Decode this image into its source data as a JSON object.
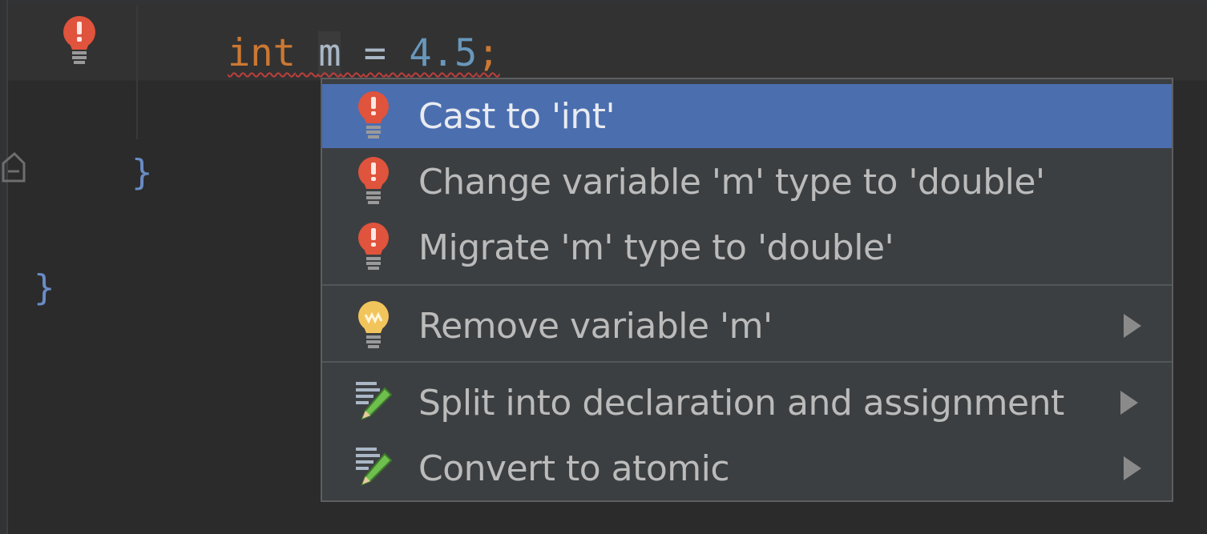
{
  "editor": {
    "code": {
      "keyword": "int",
      "variable": "m",
      "operator": "=",
      "number": "4.5",
      "semicolon": ";"
    },
    "brace_inner": "}",
    "brace_outer": "}",
    "gutter_icon": "error-bulb-icon"
  },
  "popup": {
    "items": [
      {
        "label": "Cast to 'int'",
        "icon": "red-bulb-icon",
        "selected": true,
        "submenu": false
      },
      {
        "label": "Change variable 'm' type to 'double'",
        "icon": "red-bulb-icon",
        "selected": false,
        "submenu": false
      },
      {
        "label": "Migrate 'm' type to 'double'",
        "icon": "red-bulb-icon",
        "selected": false,
        "submenu": false
      },
      {
        "label": "Remove variable 'm'",
        "icon": "yellow-bulb-icon",
        "selected": false,
        "submenu": true
      },
      {
        "label": "Split into declaration and assignment",
        "icon": "pencil-icon",
        "selected": false,
        "submenu": true
      },
      {
        "label": "Convert to atomic",
        "icon": "pencil-icon",
        "selected": false,
        "submenu": true
      }
    ]
  },
  "colors": {
    "background": "#2b2b2b",
    "popup_background": "#3c3f41",
    "selection": "#4b6eaf",
    "keyword": "#cc7832",
    "number": "#6897bb",
    "error": "#bc3f3c"
  }
}
